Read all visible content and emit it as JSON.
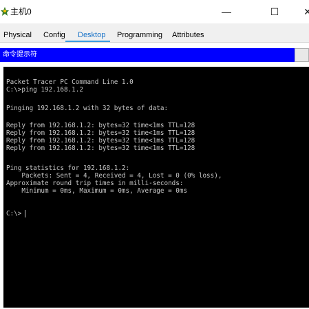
{
  "window": {
    "title": "主机0",
    "controls": {
      "minimize": "—",
      "maximize": "☐",
      "close": "✕"
    }
  },
  "tabs": [
    {
      "label": "Physical",
      "active": false
    },
    {
      "label": "Config",
      "active": false
    },
    {
      "label": "Desktop",
      "active": true
    },
    {
      "label": "Programming",
      "active": false
    },
    {
      "label": "Attributes",
      "active": false
    }
  ],
  "command_prompt": {
    "title": "命令提示符",
    "lines": [
      "Packet Tracer PC Command Line 1.0",
      "C:\\>ping 192.168.1.2",
      "Pinging 192.168.1.2 with 32 bytes of data:",
      "Reply from 192.168.1.2: bytes=32 time<1ms TTL=128",
      "Reply from 192.168.1.2: bytes=32 time<1ms TTL=128",
      "Reply from 192.168.1.2: bytes=32 time<1ms TTL=128",
      "Reply from 192.168.1.2: bytes=32 time<1ms TTL=128",
      "Ping statistics for 192.168.1.2:",
      "    Packets: Sent = 4, Received = 4, Lost = 0 (0% loss),",
      "Approximate round trip times in milli-seconds:",
      "    Minimum = 0ms, Maximum = 0ms, Average = 0ms",
      "C:\\>"
    ]
  },
  "colors": {
    "cmd_bar": "#0000ff",
    "terminal_bg": "#000000",
    "terminal_text": "#c8c8c8",
    "active_tab": "#1a73c8"
  },
  "icons": {
    "app": "packet-tracer-pc-icon"
  }
}
